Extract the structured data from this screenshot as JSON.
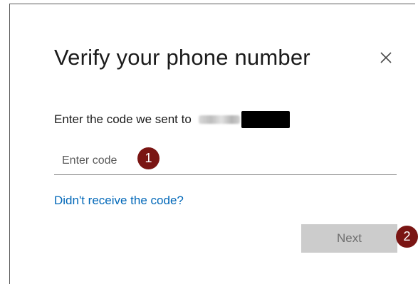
{
  "dialog": {
    "title": "Verify your phone number",
    "close_icon": "close-icon",
    "instruction": "Enter the code we sent to",
    "code_input": {
      "placeholder": "Enter code",
      "value": ""
    },
    "resend_link": "Didn't receive the code?",
    "next_button": "Next"
  },
  "annotations": {
    "badge_1": "1",
    "badge_2": "2",
    "color": "#7a1513"
  },
  "colors": {
    "link": "#0067b8",
    "button_disabled_bg": "#cccccc",
    "button_disabled_text": "#6e6e6e"
  }
}
